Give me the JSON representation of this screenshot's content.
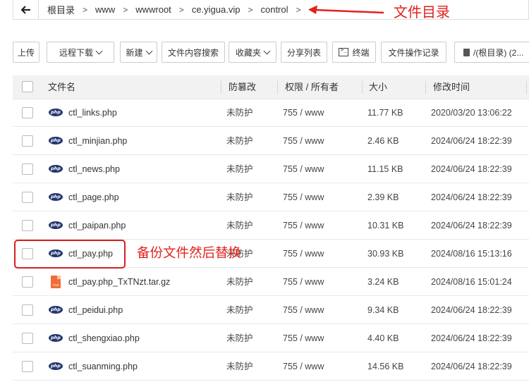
{
  "breadcrumb": [
    "根目录",
    "www",
    "wwwroot",
    "ce.yigua.vip",
    "control"
  ],
  "annotations": {
    "dir_note": "文件目录",
    "backup_note": "备份文件然后替换",
    "color": "#e0221d"
  },
  "toolbar": {
    "upload": "上传",
    "remote_download": "远程下载",
    "new": "新建",
    "content_search": "文件内容搜索",
    "favorites": "收藏夹",
    "share_list": "分享列表",
    "terminal": "终端",
    "operation_log": "文件操作记录",
    "disk": "/(根目录) (2..."
  },
  "table": {
    "headers": {
      "name": "文件名",
      "tamper": "防篡改",
      "perm": "权限 / 所有者",
      "size": "大小",
      "mtime": "修改时间"
    },
    "rows": [
      {
        "name": "ctl_links.php",
        "icon": "php-icon",
        "tamper": "未防护",
        "perm": "755 / www",
        "size": "11.77 KB",
        "mtime": "2020/03/20 13:06:22"
      },
      {
        "name": "ctl_minjian.php",
        "icon": "php-icon",
        "tamper": "未防护",
        "perm": "755 / www",
        "size": "2.46 KB",
        "mtime": "2024/06/24 18:22:39"
      },
      {
        "name": "ctl_news.php",
        "icon": "php-icon",
        "tamper": "未防护",
        "perm": "755 / www",
        "size": "11.15 KB",
        "mtime": "2024/06/24 18:22:39"
      },
      {
        "name": "ctl_page.php",
        "icon": "php-icon",
        "tamper": "未防护",
        "perm": "755 / www",
        "size": "2.39 KB",
        "mtime": "2024/06/24 18:22:39"
      },
      {
        "name": "ctl_paipan.php",
        "icon": "php-icon",
        "tamper": "未防护",
        "perm": "755 / www",
        "size": "10.31 KB",
        "mtime": "2024/06/24 18:22:39"
      },
      {
        "name": "ctl_pay.php",
        "icon": "php-icon",
        "tamper": "未防护",
        "perm": "755 / www",
        "size": "30.93 KB",
        "mtime": "2024/08/16 15:13:16"
      },
      {
        "name": "ctl_pay.php_TxTNzt.tar.gz",
        "icon": "tgz-icon",
        "tamper": "未防护",
        "perm": "755 / www",
        "size": "3.24 KB",
        "mtime": "2024/08/16 15:01:24"
      },
      {
        "name": "ctl_peidui.php",
        "icon": "php-icon",
        "tamper": "未防护",
        "perm": "755 / www",
        "size": "9.34 KB",
        "mtime": "2024/06/24 18:22:39"
      },
      {
        "name": "ctl_shengxiao.php",
        "icon": "php-icon",
        "tamper": "未防护",
        "perm": "755 / www",
        "size": "4.40 KB",
        "mtime": "2024/06/24 18:22:39"
      },
      {
        "name": "ctl_suanming.php",
        "icon": "php-icon",
        "tamper": "未防护",
        "perm": "755 / www",
        "size": "14.56 KB",
        "mtime": "2024/06/24 18:22:39"
      }
    ]
  }
}
